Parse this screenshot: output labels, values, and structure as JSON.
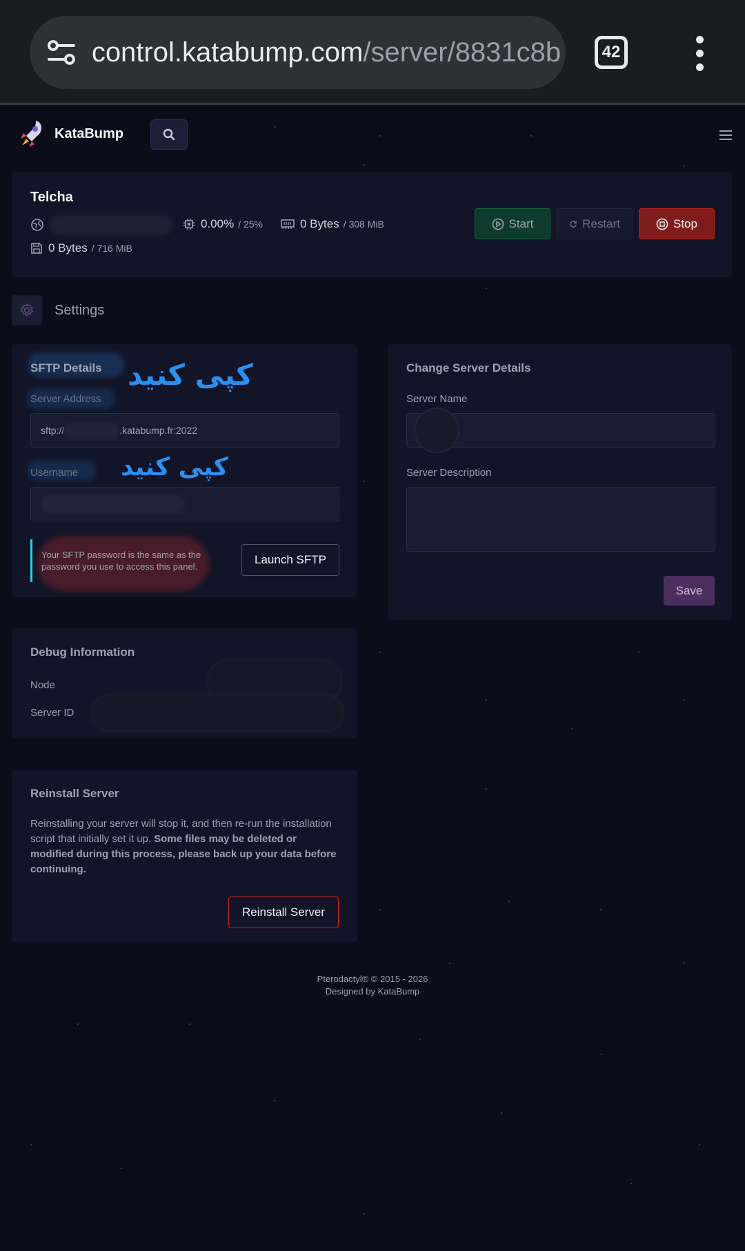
{
  "browser": {
    "url_host": "control.katabump.com",
    "url_path": "/server/8831c8b",
    "tab_count": "42"
  },
  "nav": {
    "brand": "KataBump"
  },
  "server": {
    "name": "Telcha",
    "cpu_value": "0.00%",
    "cpu_limit": "/ 25%",
    "memory_value": "0 Bytes",
    "memory_limit": "/ 308 MiB",
    "disk_value": "0 Bytes",
    "disk_limit": "/ 716 MiB",
    "buttons": {
      "start": "Start",
      "restart": "Restart",
      "stop": "Stop"
    }
  },
  "settings": {
    "title": "Settings"
  },
  "sftp": {
    "title": "SFTP Details",
    "server_address_label": "Server Address",
    "address_prefix": "sftp://",
    "address_suffix": ".katabump.fr:2022",
    "username_label": "Username",
    "info": "Your SFTP password is the same as the password you use to access this panel.",
    "launch_button": "Launch SFTP",
    "annotation_1": "کپی کنید",
    "annotation_2": "کپی کنید"
  },
  "change_details": {
    "title": "Change Server Details",
    "name_label": "Server Name",
    "description_label": "Server Description",
    "save_button": "Save"
  },
  "debug": {
    "title": "Debug Information",
    "node_label": "Node",
    "server_id_label": "Server ID"
  },
  "reinstall": {
    "title": "Reinstall Server",
    "text_plain": "Reinstalling your server will stop it, and then re-run the installation script that initially set it up. ",
    "text_bold": "Some files may be deleted or modified during this process, please back up your data before continuing.",
    "button": "Reinstall Server"
  },
  "footer": {
    "line1": "Pterodactyl® © 2015 - 2026",
    "line2": "Designed by KataBump"
  },
  "colors": {
    "background": "#0b0d1a",
    "card": "#121427",
    "start": "#0f3b2e",
    "stop": "#7f1d1d",
    "save": "#4c2f5f",
    "annotation": "#2b8ff0"
  }
}
